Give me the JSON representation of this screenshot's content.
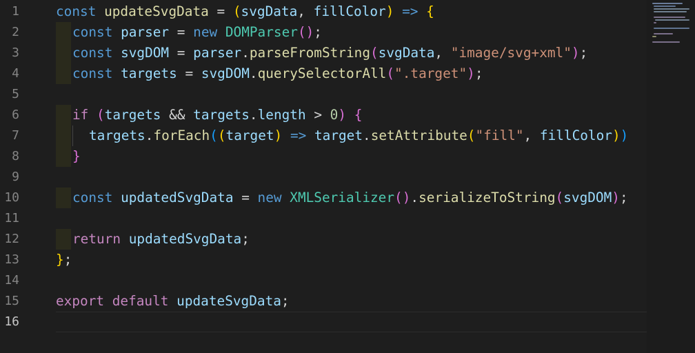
{
  "editor": {
    "line_numbers": [
      "1",
      "2",
      "3",
      "4",
      "5",
      "6",
      "7",
      "8",
      "9",
      "10",
      "11",
      "12",
      "13",
      "14",
      "15",
      "16"
    ],
    "active_line": "16",
    "file_language": "javascript"
  },
  "code": {
    "l1": [
      "const",
      " ",
      "updateSvgData",
      " = ",
      "(",
      "svgData",
      ", ",
      "fillColor",
      ")",
      " => ",
      "{"
    ],
    "l2": [
      "const",
      " ",
      "parser",
      " = ",
      "new",
      " ",
      "DOMParser",
      "()",
      ";"
    ],
    "l3": [
      "const",
      " ",
      "svgDOM",
      " = ",
      "parser",
      ".",
      "parseFromString",
      "(",
      "svgData",
      ", ",
      "\"image/svg+xml\"",
      ")",
      ";"
    ],
    "l4": [
      "const",
      " ",
      "targets",
      " = ",
      "svgDOM",
      ".",
      "querySelectorAll",
      "(",
      "\".target\"",
      ")",
      ";"
    ],
    "l6": [
      "if",
      " ",
      "(",
      "targets",
      " && ",
      "targets",
      ".",
      "length",
      " > ",
      "0",
      ")",
      " ",
      "{"
    ],
    "l7": [
      "targets",
      ".",
      "forEach",
      "(",
      "(",
      "target",
      ")",
      " => ",
      "target",
      ".",
      "setAttribute",
      "(",
      "\"fill\"",
      ", ",
      "fillColor",
      ")",
      ")"
    ],
    "l8": [
      "}"
    ],
    "l10": [
      "const",
      " ",
      "updatedSvgData",
      " = ",
      "new",
      " ",
      "XMLSerializer",
      "()",
      ".",
      "serializeToString",
      "(",
      "svgDOM",
      ")",
      ";"
    ],
    "l12": [
      "return",
      " ",
      "updatedSvgData",
      ";"
    ],
    "l13": [
      "}",
      ";"
    ],
    "l15": [
      "export",
      " ",
      "default",
      " ",
      "updateSvgData",
      ";"
    ]
  },
  "colors": {
    "background": "#1e1e1e",
    "keyword": "#569cd6",
    "control": "#c586c0",
    "variable": "#9cdcfe",
    "function": "#dcdcaa",
    "class": "#4ec9b0",
    "string": "#ce9178",
    "number": "#b5cea8",
    "bracket_level1": "#ffd700",
    "bracket_level2": "#da70d6",
    "bracket_level3": "#179fff"
  }
}
